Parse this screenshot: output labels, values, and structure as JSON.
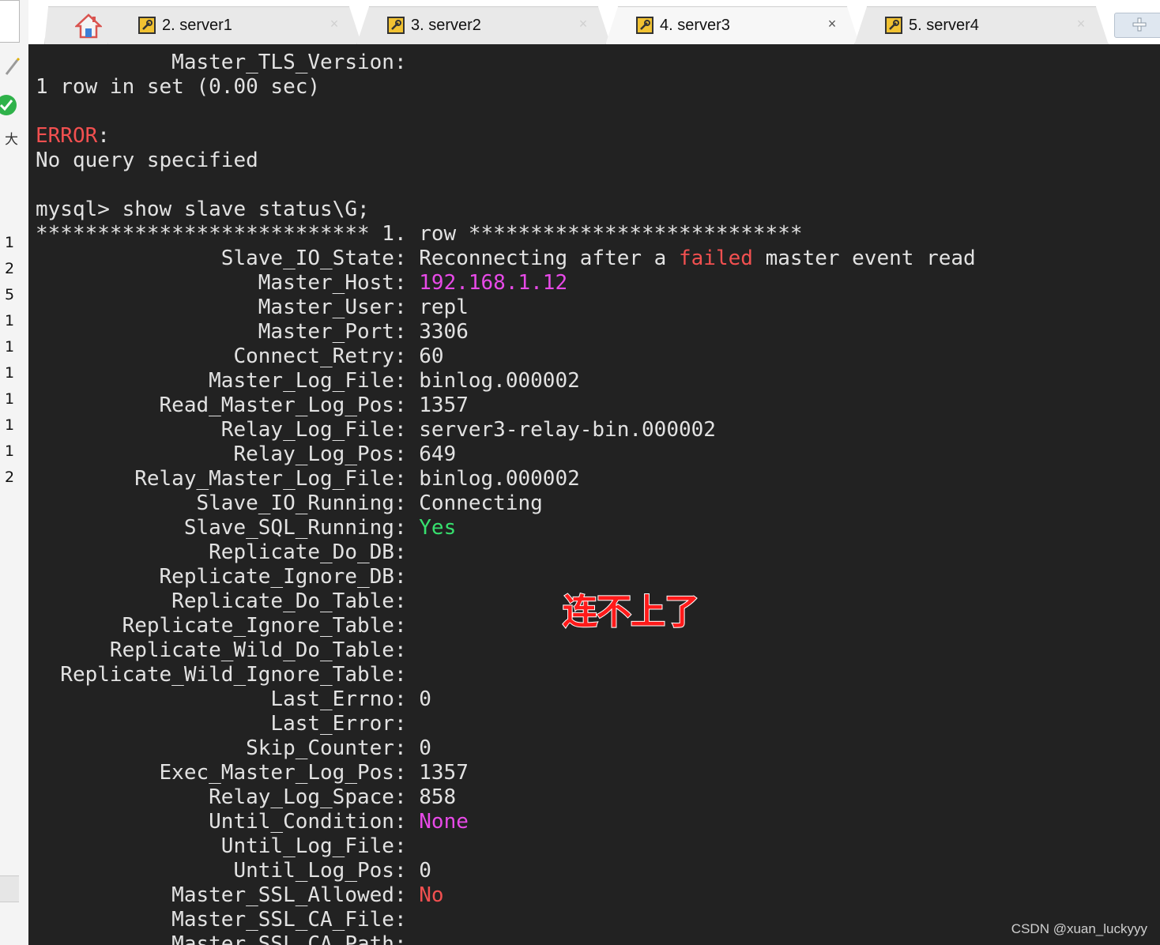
{
  "sidebar": {
    "char": "大",
    "numbers": [
      "1",
      "2",
      "5",
      "1",
      "1",
      "1",
      "1",
      "1",
      "1",
      "2"
    ]
  },
  "tabs": [
    {
      "label": "2. server1",
      "active": false
    },
    {
      "label": "3. server2",
      "active": false
    },
    {
      "label": "4. server3",
      "active": true
    },
    {
      "label": "5. server4",
      "active": false
    }
  ],
  "terminal": {
    "pre": [
      "           Master_TLS_Version:",
      "1 row in set (0.00 sec)",
      ""
    ],
    "error_label": "ERROR",
    "error_colon": ":",
    "error_msg": "No query specified",
    "blank": "",
    "command": "mysql> show slave status\\G;",
    "row_header": "*************************** 1. row ***************************",
    "io_state_key": "               Slave_IO_State: ",
    "io_state_a": "Reconnecting after a ",
    "io_state_failed": "failed",
    "io_state_b": " master event read",
    "host_key": "                  Master_Host: ",
    "host_val": "192.168.1.12",
    "fields_a": [
      "                  Master_User: repl",
      "                  Master_Port: 3306",
      "                Connect_Retry: 60",
      "              Master_Log_File: binlog.000002",
      "          Read_Master_Log_Pos: 1357",
      "               Relay_Log_File: server3-relay-bin.000002",
      "                Relay_Log_Pos: 649",
      "        Relay_Master_Log_File: binlog.000002",
      "             Slave_IO_Running: Connecting"
    ],
    "sql_key": "            Slave_SQL_Running: ",
    "sql_val": "Yes",
    "fields_b": [
      "              Replicate_Do_DB:",
      "          Replicate_Ignore_DB:",
      "           Replicate_Do_Table:",
      "       Replicate_Ignore_Table:",
      "      Replicate_Wild_Do_Table:",
      "  Replicate_Wild_Ignore_Table:",
      "                   Last_Errno: 0",
      "                   Last_Error:",
      "                 Skip_Counter: 0",
      "          Exec_Master_Log_Pos: 1357",
      "              Relay_Log_Space: 858"
    ],
    "until_key": "              Until_Condition: ",
    "until_val": "None",
    "fields_c": [
      "               Until_Log_File:",
      "                Until_Log_Pos: 0"
    ],
    "ssl_key": "           Master_SSL_Allowed: ",
    "ssl_val": "No",
    "fields_d": [
      "           Master_SSL_CA_File:",
      "           Master_SSL_CA_Path:"
    ]
  },
  "annotation": "连不上了",
  "watermark": "CSDN @xuan_luckyyy",
  "colors": {
    "terminal_bg": "#222222",
    "error": "#f25050",
    "highlight": "#e84ae8",
    "ok": "#37e06e"
  }
}
